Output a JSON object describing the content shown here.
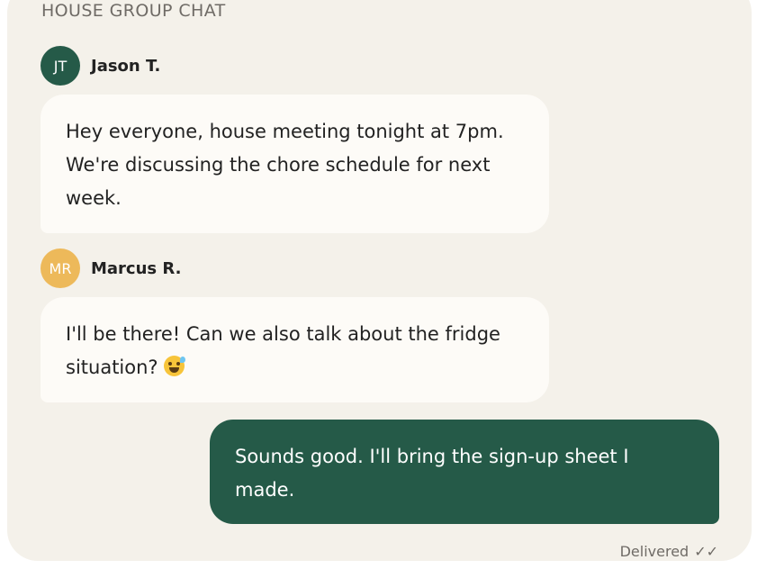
{
  "chat": {
    "title": "HOUSE GROUP CHAT"
  },
  "messages": [
    {
      "sender": "Jason T.",
      "initials": "JT",
      "avatar_color": "#255a48",
      "text": "Hey everyone, house meeting tonight at 7pm. We're discussing the chore schedule for next week."
    },
    {
      "sender": "Marcus R.",
      "initials": "MR",
      "avatar_color": "#edb95a",
      "text": "I'll be there! Can we also talk about the fridge situation?",
      "emoji": "grinning-sweat-emoji"
    },
    {
      "sender": "",
      "outgoing": true,
      "text": "Sounds good. I'll bring the sign-up sheet I made."
    }
  ],
  "status": {
    "label": "Delivered",
    "icon": "double-check-icon",
    "checks": "✓✓"
  },
  "colors": {
    "background": "#f4f1ea",
    "incoming_bubble": "#fdfbf7",
    "outgoing_bubble": "#255a48",
    "muted_text": "#6f6b66"
  }
}
